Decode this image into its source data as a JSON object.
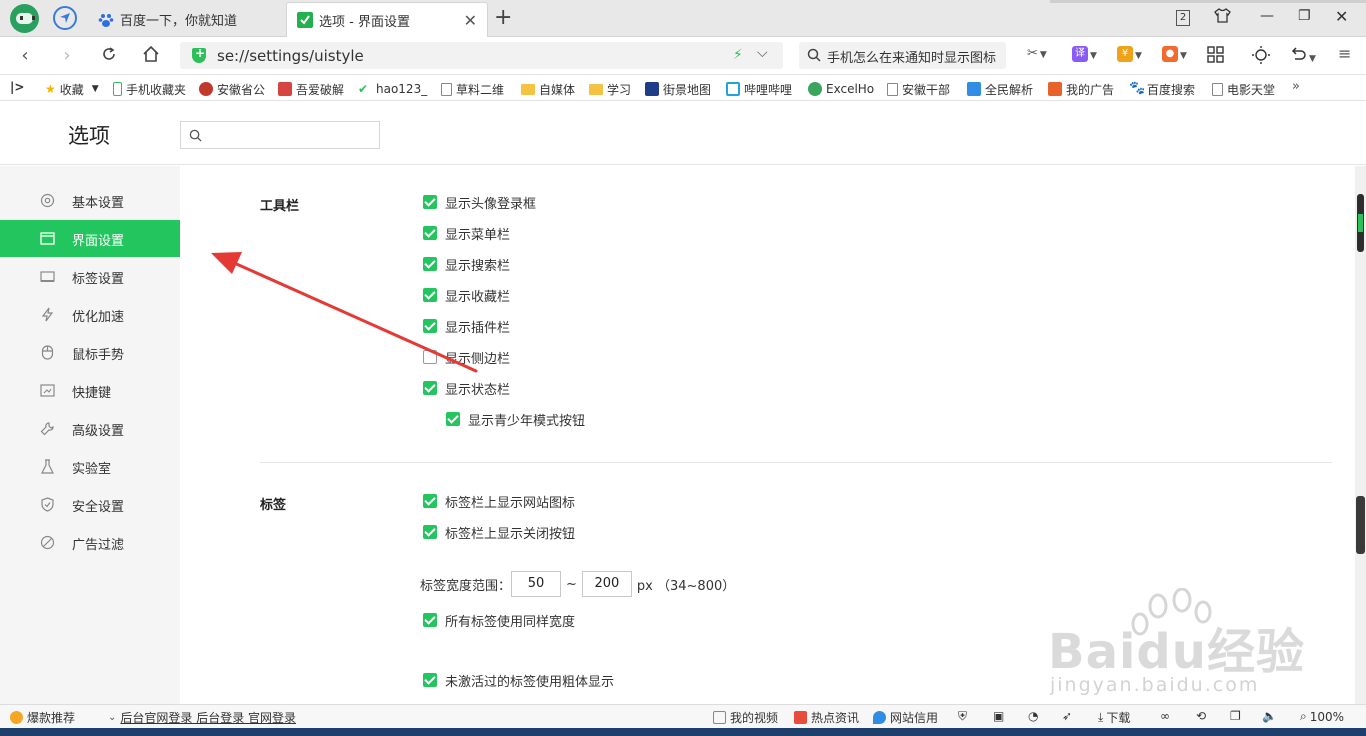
{
  "tabs": [
    {
      "title": "百度一下，你就知道",
      "active": false
    },
    {
      "title": "选项 - 界面设置",
      "active": true
    }
  ],
  "window": {
    "tab_count": "2"
  },
  "address": {
    "url": "se://settings/uistyle",
    "search_text": "手机怎么在来通知时显示图标"
  },
  "bookmarks": [
    {
      "label": "收藏"
    },
    {
      "label": "手机收藏夹"
    },
    {
      "label": "安徽省公"
    },
    {
      "label": "吾爱破解"
    },
    {
      "label": "hao123_"
    },
    {
      "label": "草料二维"
    },
    {
      "label": "自媒体"
    },
    {
      "label": "学习"
    },
    {
      "label": "街景地图"
    },
    {
      "label": "哔哩哔哩"
    },
    {
      "label": "ExcelHo"
    },
    {
      "label": "安徽干部"
    },
    {
      "label": "全民解析"
    },
    {
      "label": "我的广告"
    },
    {
      "label": "百度搜索"
    },
    {
      "label": "电影天堂"
    }
  ],
  "settings": {
    "title": "选项",
    "search_placeholder": ""
  },
  "sidebar": [
    {
      "label": "基本设置",
      "icon": "gear-icon",
      "active": false
    },
    {
      "label": "界面设置",
      "icon": "window-icon",
      "active": true
    },
    {
      "label": "标签设置",
      "icon": "tab-icon",
      "active": false
    },
    {
      "label": "优化加速",
      "icon": "lightning-icon",
      "active": false
    },
    {
      "label": "鼠标手势",
      "icon": "mouse-icon",
      "active": false
    },
    {
      "label": "快捷键",
      "icon": "keyboard-icon",
      "active": false
    },
    {
      "label": "高级设置",
      "icon": "wrench-icon",
      "active": false
    },
    {
      "label": "实验室",
      "icon": "flask-icon",
      "active": false
    },
    {
      "label": "安全设置",
      "icon": "shield-icon",
      "active": false
    },
    {
      "label": "广告过滤",
      "icon": "block-icon",
      "active": false
    }
  ],
  "toolbar_section": {
    "title": "工具栏",
    "options": [
      {
        "label": "显示头像登录框",
        "checked": true
      },
      {
        "label": "显示菜单栏",
        "checked": true
      },
      {
        "label": "显示搜索栏",
        "checked": true
      },
      {
        "label": "显示收藏栏",
        "checked": true
      },
      {
        "label": "显示插件栏",
        "checked": true
      },
      {
        "label": "显示侧边栏",
        "checked": false
      },
      {
        "label": "显示状态栏",
        "checked": true
      },
      {
        "label": "显示青少年模式按钮",
        "checked": true
      }
    ]
  },
  "tabs_section": {
    "title": "标签",
    "options": [
      {
        "label": "标签栏上显示网站图标",
        "checked": true
      },
      {
        "label": "标签栏上显示关闭按钮",
        "checked": true
      },
      {
        "label": "所有标签使用同样宽度",
        "checked": true
      },
      {
        "label": "未激活过的标签使用粗体显示",
        "checked": true
      }
    ],
    "width_label": "标签宽度范围：",
    "width_min": "50",
    "width_sep": "~",
    "width_max": "200",
    "width_unit": "px （34~800）"
  },
  "statusbar": {
    "hot": "爆款推荐",
    "link": "后台官网登录 后台登录 官网登录",
    "video": "我的视频",
    "news": "热点资讯",
    "credit": "网站信用",
    "download": "下载",
    "zoom": "100%"
  },
  "watermark": {
    "main": "Baidu经验",
    "sub": "jingyan.baidu.com"
  },
  "colors": {
    "accent": "#23c55e",
    "arrow": "#e53935"
  }
}
